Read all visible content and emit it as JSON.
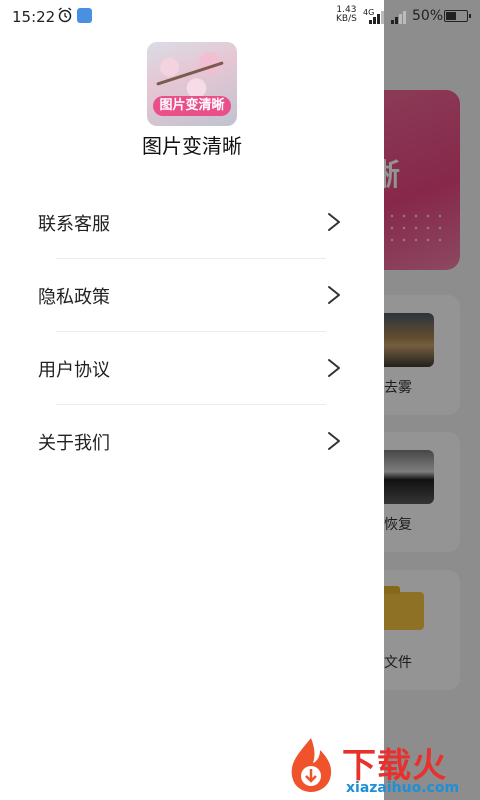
{
  "status_bar": {
    "time": "15:22",
    "speed_value": "1.43",
    "speed_unit": "KB/S",
    "network": "4G",
    "battery": "50%"
  },
  "drawer": {
    "logo_tag": "图片变清晰",
    "app_name": "图片变清晰",
    "menu": [
      {
        "label": "联系客服",
        "icon": "chevron-right-icon"
      },
      {
        "label": "隐私政策",
        "icon": "chevron-right-icon"
      },
      {
        "label": "用户协议",
        "icon": "chevron-right-icon"
      },
      {
        "label": "关于我们",
        "icon": "chevron-right-icon"
      }
    ]
  },
  "background_app": {
    "banner_char": "晰",
    "cards": [
      {
        "label": "像去雾"
      },
      {
        "label": "抻恢复"
      },
      {
        "label": "的文件"
      }
    ]
  },
  "watermark": {
    "cn": "下载火",
    "en": "xiazaihuo.com"
  },
  "colors": {
    "accent_pink": "#e8457f",
    "overlay": "rgba(0,0,0,0.42)",
    "watermark_red": "#e8312c",
    "watermark_blue": "#1f8fd6"
  }
}
